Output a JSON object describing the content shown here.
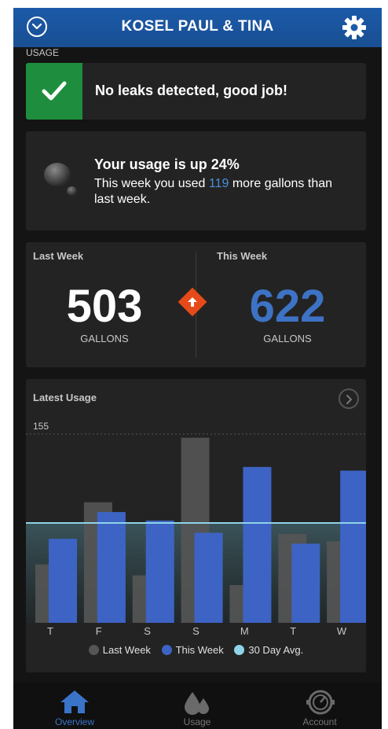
{
  "header": {
    "title": "KOSEL PAUL & TINA"
  },
  "section_label": "USAGE",
  "leak_card": {
    "message": "No leaks detected, good job!"
  },
  "trend_card": {
    "title": "Your usage is up 24%",
    "sub_before": "This week you used ",
    "sub_value": "119",
    "sub_after": " more gallons than last week."
  },
  "comparison": {
    "last_week_label": "Last Week",
    "last_week_value": "503",
    "this_week_label": "This Week",
    "this_week_value": "622",
    "unit": "GALLONS"
  },
  "chart_title": "Latest Usage",
  "chart_data": {
    "type": "bar",
    "categories": [
      "T",
      "F",
      "S",
      "S",
      "M",
      "T",
      "W"
    ],
    "series": [
      {
        "name": "Last Week",
        "values": [
          48,
          99,
          39,
          152,
          31,
          73,
          67
        ]
      },
      {
        "name": "This Week",
        "values": [
          69,
          91,
          84,
          74,
          128,
          65,
          125
        ]
      }
    ],
    "reference_line": {
      "name": "30 Day Avg.",
      "value": 82
    },
    "ylim": [
      0,
      155
    ],
    "y_tick_label": "155",
    "legend_position": "bottom"
  },
  "colors": {
    "last_week": "#555555",
    "this_week": "#3d64c4",
    "avg": "#8fd3e8",
    "accent": "#1b5aa8",
    "success": "#1e8e3e",
    "alert": "#e64a19"
  },
  "tabs": [
    {
      "label": "Overview",
      "icon": "home-icon"
    },
    {
      "label": "Usage",
      "icon": "water-drops-icon"
    },
    {
      "label": "Account",
      "icon": "meter-icon"
    }
  ]
}
